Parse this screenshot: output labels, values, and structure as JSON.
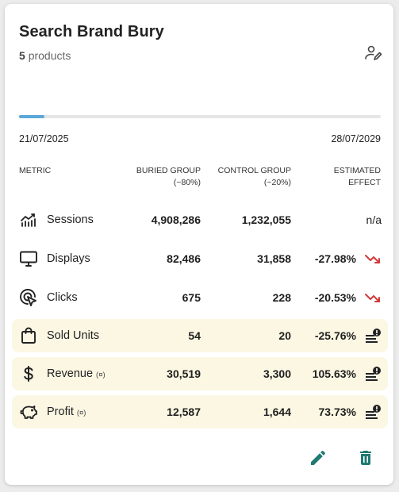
{
  "card": {
    "title": "Search Brand Bury",
    "product_count": "5",
    "product_label": "products",
    "progress_fraction": 0.07,
    "start_date": "21/07/2025",
    "end_date": "28/07/2029"
  },
  "table": {
    "headers": {
      "metric": "METRIC",
      "buried": "BURIED GROUP",
      "buried_sub": "(~80%)",
      "control": "CONTROL GROUP",
      "control_sub": "(~20%)",
      "effect": "ESTIMATED",
      "effect_sub": "EFFECT"
    },
    "rows": [
      {
        "label": "Sessions",
        "suffix": "",
        "buried": "4,908,286",
        "control": "1,232,055",
        "effect": "n/a",
        "icon": "sessions-chart-icon",
        "effect_icon": "",
        "highlight": false
      },
      {
        "label": "Displays",
        "suffix": "",
        "buried": "82,486",
        "control": "31,858",
        "effect": "-27.98%",
        "icon": "monitor-icon",
        "effect_icon": "trend-down-icon",
        "highlight": false
      },
      {
        "label": "Clicks",
        "suffix": "",
        "buried": "675",
        "control": "228",
        "effect": "-20.53%",
        "icon": "cursor-click-icon",
        "effect_icon": "trend-down-icon",
        "highlight": false
      },
      {
        "label": "Sold Units",
        "suffix": "",
        "buried": "54",
        "control": "20",
        "effect": "-25.76%",
        "icon": "shopping-bag-icon",
        "effect_icon": "list-alert-icon",
        "highlight": true
      },
      {
        "label": "Revenue",
        "suffix": "(¤)",
        "buried": "30,519",
        "control": "3,300",
        "effect": "105.63%",
        "icon": "dollar-icon",
        "effect_icon": "list-alert-icon",
        "highlight": true
      },
      {
        "label": "Profit",
        "suffix": "(¤)",
        "buried": "12,587",
        "control": "1,644",
        "effect": "73.73%",
        "icon": "piggy-bank-icon",
        "effect_icon": "list-alert-icon",
        "highlight": true
      }
    ]
  },
  "colors": {
    "accent_teal": "#1f7a72",
    "trend_down": "#d23a3a",
    "progress": "#5aa8d8",
    "highlight_row": "#fbf7e3"
  }
}
